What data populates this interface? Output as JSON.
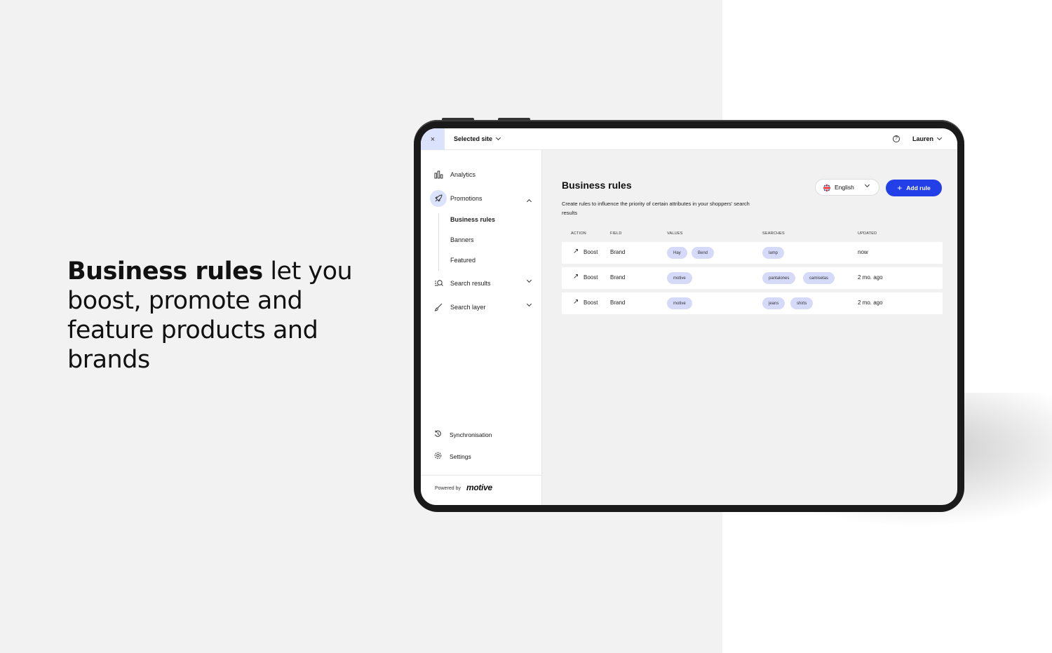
{
  "headline": {
    "bold": "Business rules",
    "rest": " let you boost, promote and feature products and brands"
  },
  "topbar": {
    "close": "×",
    "site_label": "Selected site",
    "help": "?",
    "user": "Lauren"
  },
  "sidebar": {
    "items": [
      {
        "label": "Analytics",
        "icon": "bar-chart-icon"
      },
      {
        "label": "Promotions",
        "icon": "rocket-icon"
      },
      {
        "label": "Search results",
        "icon": "search-list-icon"
      },
      {
        "label": "Search layer",
        "icon": "brush-icon"
      }
    ],
    "sub_items": [
      "Business rules",
      "Banners",
      "Featured"
    ],
    "bottom": [
      {
        "label": "Synchronisation",
        "icon": "sync-icon"
      },
      {
        "label": "Settings",
        "icon": "gear-icon"
      }
    ],
    "powered_by": "Powered by",
    "logo": "motive"
  },
  "main": {
    "title": "Business rules",
    "description": "Create rules to influence the priority of certain attributes in your shoppers' search results",
    "language": "English",
    "add_rule": "Add rule",
    "columns": [
      "ACTION",
      "FIELD",
      "VALUES",
      "SEARCHES",
      "UPDATED"
    ],
    "rows": [
      {
        "action": "Boost",
        "field": "Brand",
        "values": [
          "Hay",
          "Bend"
        ],
        "searches": [
          "lamp"
        ],
        "updated": "now"
      },
      {
        "action": "Boost",
        "field": "Brand",
        "values": [
          "motive"
        ],
        "searches": [
          "pantalones",
          "camisetas"
        ],
        "updated": "2 mo. ago"
      },
      {
        "action": "Boost",
        "field": "Brand",
        "values": [
          "motive"
        ],
        "searches": [
          "jeans",
          "shirts"
        ],
        "updated": "2 mo. ago"
      }
    ]
  },
  "colors": {
    "accent": "#2340e8",
    "chip": "#d5daf9",
    "active_nav": "#dbe2fb"
  }
}
